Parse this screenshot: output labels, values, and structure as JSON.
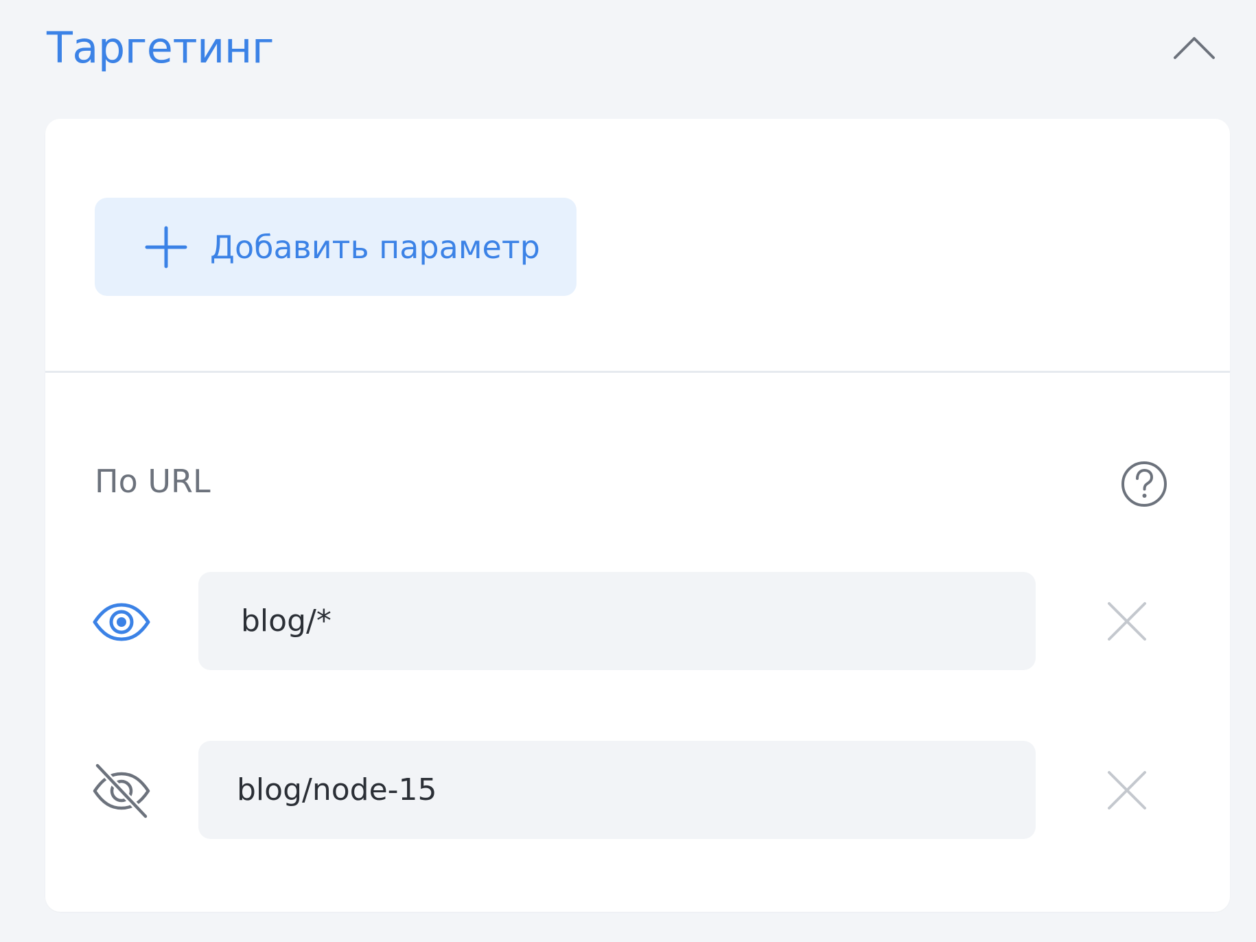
{
  "section": {
    "title": "Таргетинг",
    "title_color": "#3b82e6",
    "collapse_icon": "chevron-up-icon"
  },
  "add_parameter": {
    "label": "Добавить параметр",
    "icon": "plus-icon"
  },
  "url_targeting": {
    "label": "По URL",
    "help_icon": "question-circle-icon",
    "rules": [
      {
        "value": "blog/*",
        "visibility": "show",
        "icon": "eye-icon",
        "icon_color": "#3b82e6"
      },
      {
        "value": "blog/node-15",
        "visibility": "hide",
        "icon": "eye-off-icon",
        "icon_color": "#6c727c"
      }
    ],
    "remove_icon": "close-icon"
  }
}
